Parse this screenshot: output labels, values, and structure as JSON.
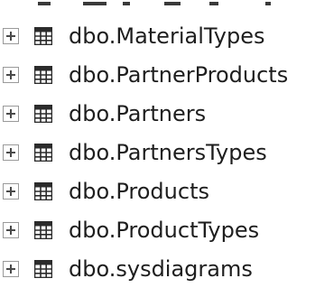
{
  "object_explorer": {
    "tables": [
      {
        "name": "dbo.MaterialTypes"
      },
      {
        "name": "dbo.PartnerProducts"
      },
      {
        "name": "dbo.Partners"
      },
      {
        "name": "dbo.PartnersTypes"
      },
      {
        "name": "dbo.Products"
      },
      {
        "name": "dbo.ProductTypes"
      },
      {
        "name": "dbo.sysdiagrams"
      }
    ]
  }
}
